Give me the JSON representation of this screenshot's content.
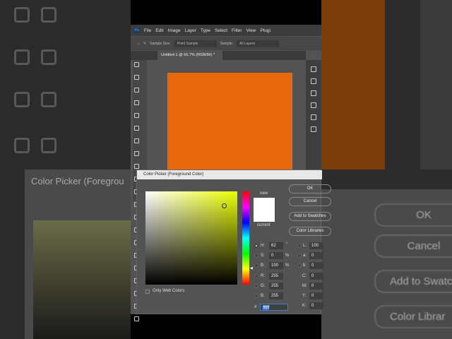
{
  "app": {
    "menu": [
      "File",
      "Edit",
      "Image",
      "Layer",
      "Type",
      "Select",
      "Filter",
      "View",
      "Plugi"
    ],
    "options": {
      "sample_size_label": "Sample Size:",
      "sample_size_value": "Point Sample",
      "sample_label": "Sample:",
      "sample_value": "All Layers"
    },
    "document_tab": "Untitled-1 @ 66.7% (RGB/8#) *"
  },
  "canvas_color": "#e8690d",
  "dialog": {
    "title": "Color Picker (Foreground Color)",
    "new_label": "new",
    "current_label": "current",
    "buttons": {
      "ok": "OK",
      "cancel": "Cancel",
      "add": "Add to Swatches",
      "libraries": "Color Libraries"
    },
    "only_web": "Only Web Colors",
    "hsb": [
      {
        "label": "H:",
        "value": "62",
        "unit": "°"
      },
      {
        "label": "S:",
        "value": "0",
        "unit": "%"
      },
      {
        "label": "B:",
        "value": "100",
        "unit": "%"
      }
    ],
    "rgb": [
      {
        "label": "R:",
        "value": "255"
      },
      {
        "label": "G:",
        "value": "255"
      },
      {
        "label": "B:",
        "value": "255"
      }
    ],
    "lab": [
      {
        "label": "L:",
        "value": "100"
      },
      {
        "label": "a:",
        "value": "0"
      },
      {
        "label": "b:",
        "value": "0"
      }
    ],
    "cmyk": [
      {
        "label": "C:",
        "value": "0"
      },
      {
        "label": "M:",
        "value": "0"
      },
      {
        "label": "Y:",
        "value": "0"
      },
      {
        "label": "K:",
        "value": "0"
      }
    ],
    "hex_label": "#",
    "hex": "ffffff"
  },
  "bg": {
    "dialog_title": "Color Picker (Foregrou",
    "ok": "OK",
    "cancel": "Cancel",
    "add": "Add to Swatch",
    "libraries": "Color Librar"
  }
}
